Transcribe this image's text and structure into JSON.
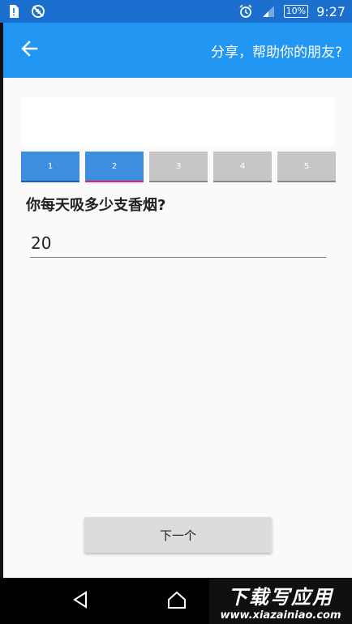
{
  "status_bar": {
    "battery": "10%",
    "time": "9:27"
  },
  "app_bar": {
    "title": "分享，帮助你的朋友?"
  },
  "steps": [
    {
      "label": "1",
      "state": "done"
    },
    {
      "label": "2",
      "state": "active"
    },
    {
      "label": "3",
      "state": "todo"
    },
    {
      "label": "4",
      "state": "todo"
    },
    {
      "label": "5",
      "state": "todo"
    }
  ],
  "question": {
    "text": "你每天吸多少支香烟?",
    "value": "20"
  },
  "next_button": {
    "label": "下一个"
  },
  "watermark": {
    "main": "下载写应用",
    "sub": "www.xiazainiao.com"
  },
  "colors": {
    "status_bar": "#1b6fcf",
    "app_bar": "#2196f3",
    "step_done": "#3e8ee0",
    "step_todo": "#c6c6c6",
    "step_active_indicator": "#e91e63"
  }
}
